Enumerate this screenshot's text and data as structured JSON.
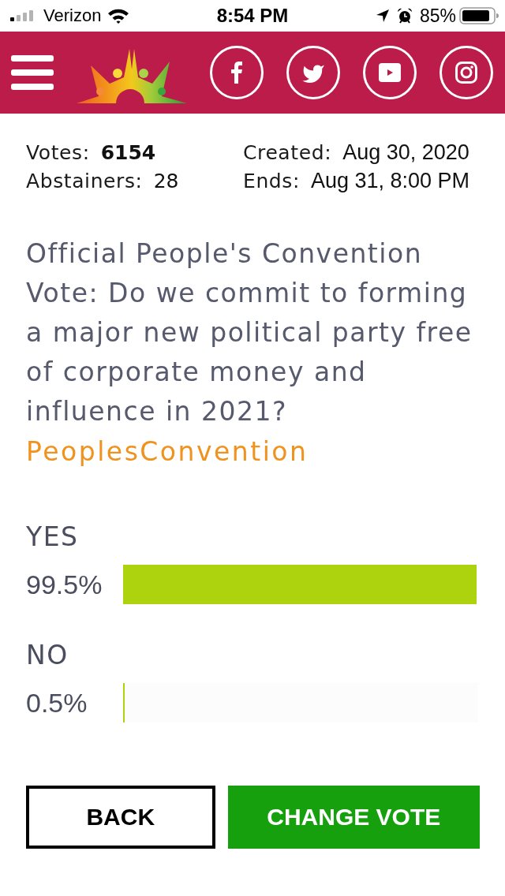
{
  "status_bar": {
    "carrier": "Verizon",
    "time": "8:54 PM",
    "battery": "85%"
  },
  "poll_info": {
    "columns": [
      {
        "items": [
          {
            "label": "Votes:",
            "value": "6154",
            "kind": "count",
            "bold": true
          },
          {
            "label": "Abstainers:",
            "value": "28",
            "kind": "count",
            "bold": false
          }
        ]
      },
      {
        "items": [
          {
            "label": "Created:",
            "value": "Aug 30, 2020",
            "kind": "date",
            "bold": false
          },
          {
            "label": "Ends:",
            "value": "Aug 31, 8:00 PM",
            "kind": "date",
            "bold": false
          }
        ]
      }
    ]
  },
  "question": {
    "text": "Official People's Convention Vote: Do we commit to forming a major new political party free of corporate money and influence in 2021?",
    "tag": "PeoplesConvention"
  },
  "options": [
    {
      "label": "YES",
      "percent": "99.5%",
      "level": 0.995
    },
    {
      "label": "NO",
      "percent": "0.5%",
      "level": 0.005
    }
  ],
  "buttons": [
    {
      "label": "BACK",
      "kind": "outline"
    },
    {
      "label": "CHANGE VOTE",
      "kind": "primary"
    }
  ]
}
